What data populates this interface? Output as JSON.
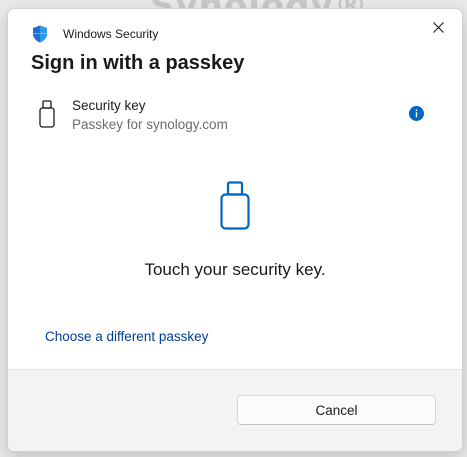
{
  "backdrop": {
    "logo_text": "Synology®"
  },
  "window": {
    "app_title": "Windows Security",
    "app_icon": "shield-icon",
    "close_icon": "close-icon"
  },
  "dialog": {
    "heading": "Sign in with a passkey",
    "authenticator": {
      "title": "Security key",
      "subtitle": "Passkey for synology.com",
      "icon": "usb-key-icon",
      "info_icon": "info-icon"
    },
    "prompt": "Touch your security key.",
    "alternate_link": "Choose a different passkey",
    "cancel_label": "Cancel"
  },
  "colors": {
    "accent": "#0067c0",
    "link": "#003e92",
    "footer_bg": "#f3f3f3"
  }
}
